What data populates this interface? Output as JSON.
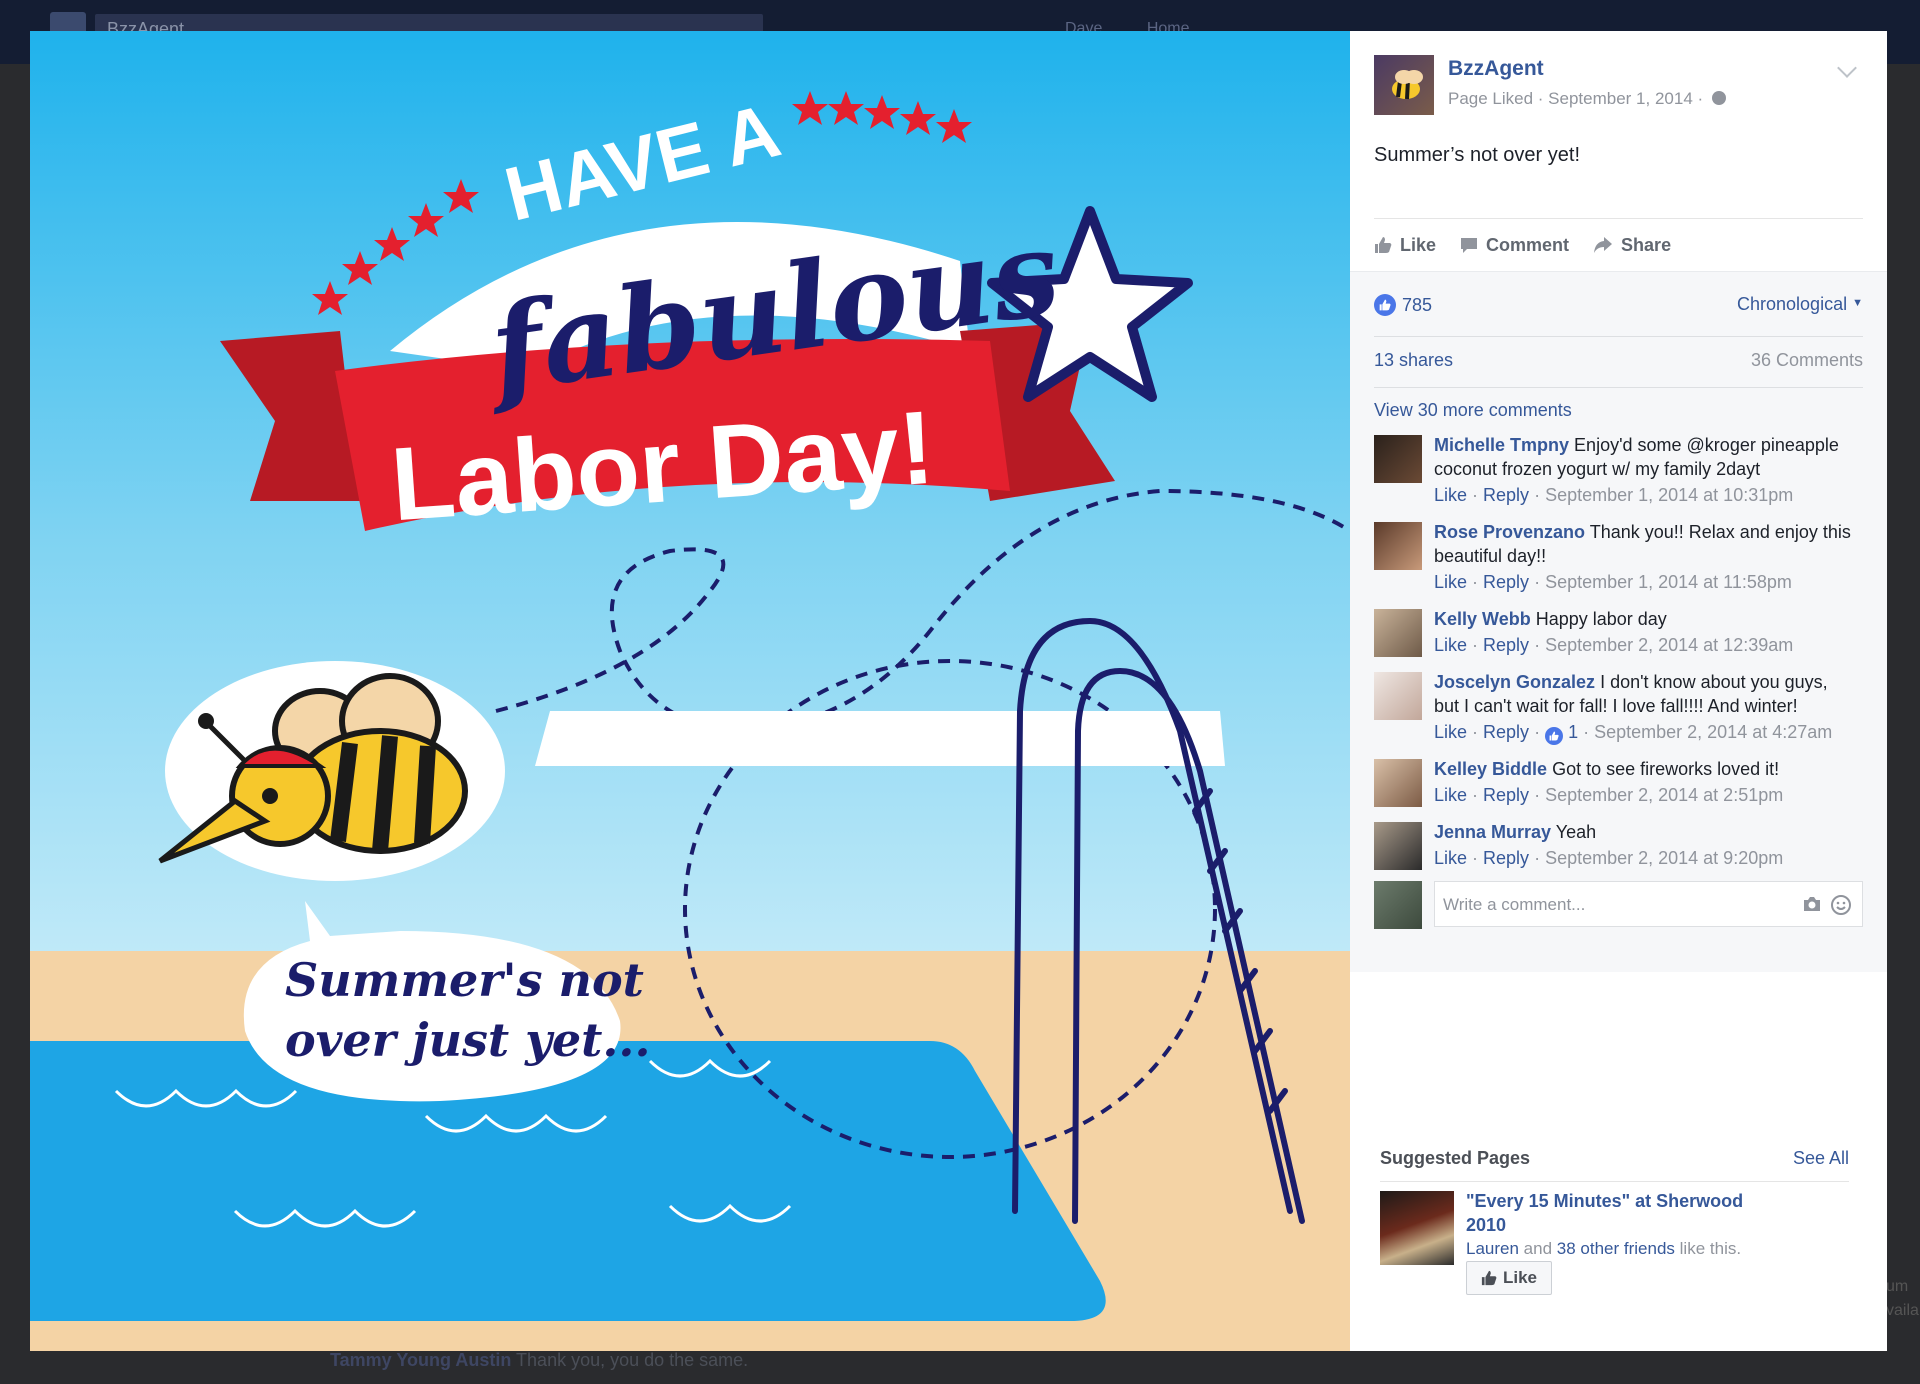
{
  "background": {
    "search_text": "BzzAgent",
    "nav": [
      "Dave",
      "Home"
    ],
    "bottom_comment_name": "Tammy Young Austin",
    "bottom_comment_text": "Thank you, you do the same.",
    "right_text_1": "um",
    "right_text_2": "vaila"
  },
  "photo": {
    "line1": "HAVE A",
    "line2": "fabulous",
    "line3": "Labor Day!",
    "bubble_line1": "Summer's not",
    "bubble_line2": "over just yet...",
    "colors": {
      "sky": "#3fc0ef",
      "ribbon": "#e4202e",
      "navy": "#1b1d6b",
      "sand": "#f4d3a5",
      "pool": "#1ea5e5"
    }
  },
  "post": {
    "page_name": "BzzAgent",
    "meta": "Page Liked · September 1, 2014 ·",
    "text": "Summer’s not over yet!",
    "actions": {
      "like": "Like",
      "comment": "Comment",
      "share": "Share"
    },
    "likes_count": "785",
    "sort_label": "Chronological",
    "shares": "13 shares",
    "comments_count": "36 Comments",
    "view_more": "View 30 more comments"
  },
  "comments": [
    {
      "name": "Michelle Tmpny",
      "text": "Enjoy'd some @kroger pineapple coconut frozen yogurt w/ my family 2dayt",
      "like": "Like",
      "reply": "Reply",
      "time": "September 1, 2014 at 10:31pm"
    },
    {
      "name": "Rose Provenzano",
      "text": "Thank you!! Relax and enjoy this beautiful day!!",
      "like": "Like",
      "reply": "Reply",
      "time": "September 1, 2014 at 11:58pm"
    },
    {
      "name": "Kelly Webb",
      "text": "Happy labor day",
      "like": "Like",
      "reply": "Reply",
      "time": "September 2, 2014 at 12:39am"
    },
    {
      "name": "Joscelyn Gonzalez",
      "text": "I don't know about you guys, but I can't wait for fall! I love fall!!!! And winter!",
      "like": "Like",
      "reply": "Reply",
      "likes": "1",
      "time": "September 2, 2014 at 4:27am"
    },
    {
      "name": "Kelley Biddle",
      "text": "Got to see fireworks loved it!",
      "like": "Like",
      "reply": "Reply",
      "time": "September 2, 2014 at 2:51pm"
    },
    {
      "name": "Jenna Murray",
      "text": "Yeah",
      "like": "Like",
      "reply": "Reply",
      "time": "September 2, 2014 at 9:20pm"
    }
  ],
  "composer": {
    "placeholder": "Write a comment..."
  },
  "suggested": {
    "title": "Suggested Pages",
    "see_all": "See All",
    "page_name": "\"Every 15 Minutes\" at Sherwood 2010",
    "friend1": "Lauren",
    "and": "and",
    "others": "38 other friends",
    "suffix": "like this.",
    "like_label": "Like"
  }
}
